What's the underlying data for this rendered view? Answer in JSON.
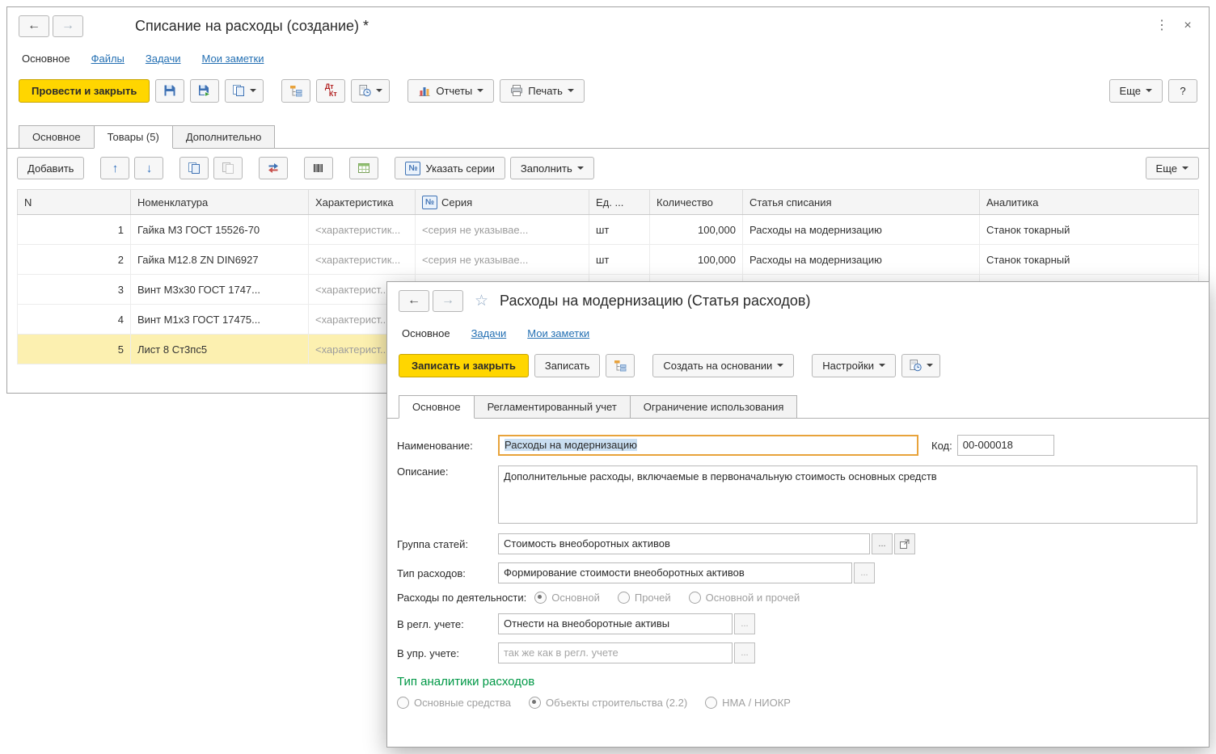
{
  "icons": {
    "back": "←",
    "forward": "→",
    "menu": "⋮",
    "close": "×",
    "star": "☆",
    "up": "↑",
    "down": "↓",
    "help": "?"
  },
  "back": {
    "title": "Списание на расходы (создание) *",
    "nav": {
      "main": "Основное",
      "files": "Файлы",
      "tasks": "Задачи",
      "notes": "Мои заметки"
    },
    "toolbar": {
      "post_close": "Провести и закрыть",
      "dt": "Дт",
      "kt": "Кт",
      "reports": "Отчеты",
      "print": "Печать",
      "more": "Еще",
      "help": "?"
    },
    "tabs": {
      "main": "Основное",
      "goods": "Товары (5)",
      "extra": "Дополнительно"
    },
    "grid_toolbar": {
      "add": "Добавить",
      "series_no": "№",
      "set_series": "Указать серии",
      "fill": "Заполнить",
      "more": "Еще"
    },
    "grid": {
      "columns": {
        "n": "N",
        "nomenclature": "Номенклатура",
        "characteristic": "Характеристика",
        "series_no": "№",
        "series": "Серия",
        "unit": "Ед. ...",
        "qty": "Количество",
        "expense_item": "Статья списания",
        "analytics": "Аналитика"
      },
      "rows": [
        {
          "n": "1",
          "nomenclature": "Гайка М3 ГОСТ 15526-70",
          "characteristic": "<характеристик...",
          "series": "<серия не указывае...",
          "unit": "шт",
          "qty": "100,000",
          "expense_item": "Расходы на модернизацию",
          "analytics": "Станок токарный"
        },
        {
          "n": "2",
          "nomenclature": "Гайка М12.8 ZN DIN6927",
          "characteristic": "<характеристик...",
          "series": "<серия не указывае...",
          "unit": "шт",
          "qty": "100,000",
          "expense_item": "Расходы на модернизацию",
          "analytics": "Станок токарный"
        },
        {
          "n": "3",
          "nomenclature": "Винт М3х30 ГОСТ 1747...",
          "characteristic": "<характерист...",
          "series": "",
          "unit": "",
          "qty": "",
          "expense_item": "",
          "analytics": ""
        },
        {
          "n": "4",
          "nomenclature": "Винт М1х3 ГОСТ 17475...",
          "characteristic": "<характерист...",
          "series": "",
          "unit": "",
          "qty": "",
          "expense_item": "",
          "analytics": ""
        },
        {
          "n": "5",
          "nomenclature": "Лист 8 Ст3пс5",
          "characteristic": "<характерист...",
          "series": "",
          "unit": "",
          "qty": "",
          "expense_item": "",
          "analytics": ""
        }
      ]
    }
  },
  "front": {
    "title": "Расходы на модернизацию (Статья расходов)",
    "nav": {
      "main": "Основное",
      "tasks": "Задачи",
      "notes": "Мои заметки"
    },
    "toolbar": {
      "save_close": "Записать и закрыть",
      "save": "Записать",
      "create_based": "Создать на основании",
      "settings": "Настройки"
    },
    "tabs": {
      "main": "Основное",
      "regulated": "Регламентированный учет",
      "restriction": "Ограничение использования"
    },
    "form": {
      "name_label": "Наименование:",
      "name_value": "Расходы на модернизацию",
      "code_label": "Код:",
      "code_value": "00-000018",
      "description_label": "Описание:",
      "description_value": "Дополнительные расходы, включаемые в первоначальную стоимость основных средств",
      "group_label": "Группа статей:",
      "group_value": "Стоимость внеоборотных активов",
      "type_label": "Тип расходов:",
      "type_value": "Формирование стоимости внеоборотных активов",
      "activity_label": "Расходы по деятельности:",
      "activity_main": "Основной",
      "activity_other": "Прочей",
      "activity_both": "Основной и прочей",
      "reg_label": "В регл. учете:",
      "reg_value": "Отнести на внеоборотные активы",
      "mgmt_label": "В упр. учете:",
      "mgmt_value": "так же как в регл. учете",
      "analytics_header": "Тип аналитики расходов",
      "analytics_fixed_assets": "Основные средства",
      "analytics_construction": "Объекты строительства (2.2)",
      "analytics_nma": "НМА / НИОКР",
      "ellipsis": "..."
    }
  }
}
